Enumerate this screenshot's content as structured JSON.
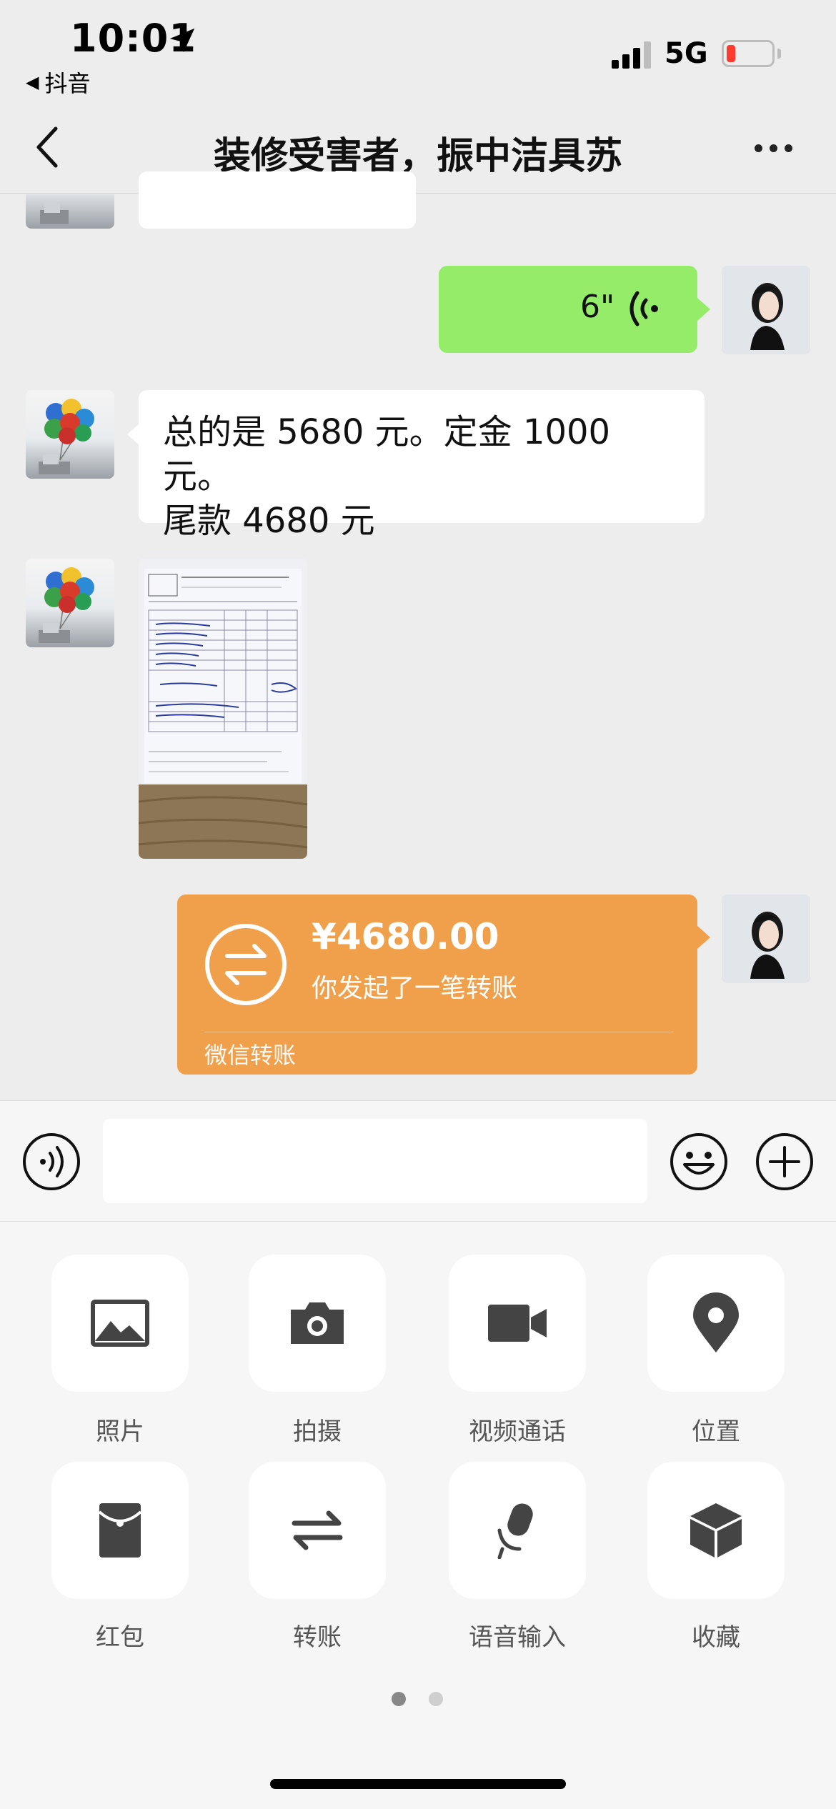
{
  "status_bar": {
    "time": "10:01",
    "back_app": "抖音",
    "network": "5G"
  },
  "nav": {
    "title": "装修受害者，振中洁具苏"
  },
  "messages": {
    "voice": {
      "duration": "6\""
    },
    "text": {
      "line1": "总的是 5680 元。定金 1000 元。",
      "line2": "尾款 4680 元"
    },
    "transfer": {
      "amount": "¥4680.00",
      "description": "你发起了一笔转账",
      "label": "微信转账"
    }
  },
  "panel": {
    "items": [
      {
        "label": "照片",
        "icon": "photo-icon"
      },
      {
        "label": "拍摄",
        "icon": "camera-icon"
      },
      {
        "label": "视频通话",
        "icon": "video-call-icon"
      },
      {
        "label": "位置",
        "icon": "location-icon"
      },
      {
        "label": "红包",
        "icon": "red-packet-icon"
      },
      {
        "label": "转账",
        "icon": "transfer-icon"
      },
      {
        "label": "语音输入",
        "icon": "microphone-icon"
      },
      {
        "label": "收藏",
        "icon": "favorites-icon"
      }
    ],
    "pages": {
      "count": 2,
      "active": 1
    }
  },
  "colors": {
    "background": "#ededed",
    "green_bubble": "#95ec69",
    "transfer_orange": "#f0a04b",
    "battery_low": "#ff3b30"
  }
}
